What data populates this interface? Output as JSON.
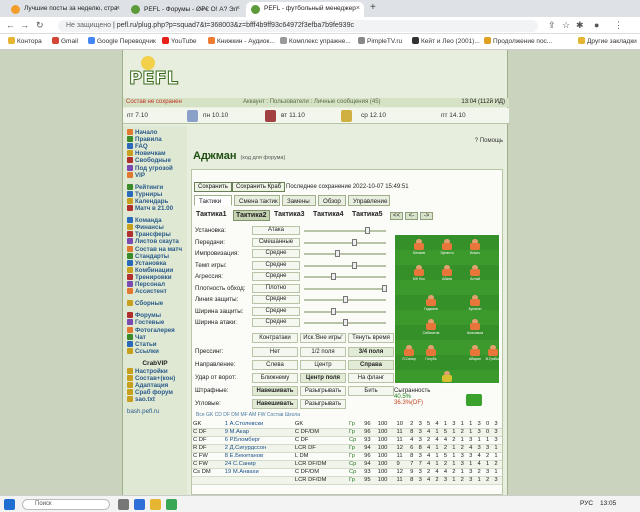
{
  "browser": {
    "tabs": [
      {
        "label": "Лучшие посты за неделю, стра",
        "close": "×"
      },
      {
        "label": "PEFL - Форумы - Ø₽€ О! А? Эл",
        "close": "×"
      },
      {
        "label": "PEFL - футбольный менеджер",
        "close": "×"
      }
    ],
    "new_tab": "+",
    "url_prefix": "Не защищено",
    "url": "pefl.ru/plug.php?p=squad7&t=368003&z=bfff4b9ff93c64972f3efba7b9fe939c",
    "bookmarks": [
      "Контора",
      "Gmail",
      "Google Переводчик",
      "YouTube",
      "Книжкин - Аудиок...",
      "Комплекс упражне...",
      "PimpleTV.ru",
      "Кейт и Лео (2001)...",
      "Продолжение пос...",
      "Другие закладки"
    ]
  },
  "site": {
    "logo_text": "PEFL",
    "status_left": "Состав не сохранен",
    "status_mid": "Аккаунт : Пользователи : Личные сообщения (45)",
    "status_right": "13:04 (112й ИД)",
    "matches": [
      {
        "day": "пт 7.10"
      },
      {
        "day": "пн 10.10"
      },
      {
        "day": "вт 11.10"
      },
      {
        "day": "ср 12.10"
      },
      {
        "day": "пт 14.10"
      }
    ]
  },
  "sidebar": {
    "groups": [
      [
        "Начало",
        "Правила",
        "FAQ",
        "Новичкам",
        "Свободные",
        "Под угрозой",
        "VIP"
      ],
      [
        "Рейтинги",
        "Турниры",
        "Календарь",
        "Матч в 21.00"
      ],
      [
        "Команда",
        "Финансы",
        "Трансферы",
        "Листов скаута",
        "Состав на матч",
        "Стандарты",
        "Установка",
        "Комбинации",
        "Тренировки",
        "Персонал",
        "Ассистент"
      ],
      [
        "Сборные"
      ],
      [
        "Форумы",
        "Гостевые",
        "Фотогалерея",
        "Чат",
        "Статьи",
        "Ссылки"
      ]
    ],
    "crabvip_title": "CrabVIP",
    "crabvip_items": [
      "Настройки",
      "Состав+(кон)",
      "Адаптация",
      "Cраб форум",
      "sao.txt"
    ],
    "bottom_link": "bash.pefl.ru"
  },
  "main": {
    "help": "Помощь",
    "team_name": "Аджман",
    "team_note": "(код для форума)",
    "save_label": "Сохранить",
    "save_crab_label": "Сохранить Краб",
    "last_saved": "Последнее сохранение 2022-10-07 15:49:51",
    "tabs": [
      "Тактики",
      "Смена тактик",
      "Замены",
      "Обзор",
      "Управление"
    ],
    "tactics": [
      "Тактика1",
      "Тактика2",
      "Тактика3",
      "Тактика4",
      "Тактика5"
    ],
    "tactic_nav": [
      "<<",
      "<-",
      "->"
    ],
    "settings": [
      {
        "label": "Установка:",
        "value": "Атака",
        "level": 0.78
      },
      {
        "label": "Передачи:",
        "value": "Смешанные",
        "level": 0.62
      },
      {
        "label": "Импровизация:",
        "value": "Средне",
        "level": 0.4
      },
      {
        "label": "Темп игры:",
        "value": "Средне",
        "level": 0.62
      },
      {
        "label": "Агрессия:",
        "value": "Средне",
        "level": 0.35
      },
      {
        "label": "Плотность обход:",
        "value": "Плотно",
        "level": 1.0
      },
      {
        "label": "Линия защиты:",
        "value": "Средне",
        "level": 0.5
      },
      {
        "label": "Ширина защиты:",
        "value": "Средне",
        "level": 0.35
      },
      {
        "label": "Ширина атаки:",
        "value": "Средне",
        "level": 0.5
      }
    ],
    "kontr": [
      "Контратаки",
      "Иск.'Вне игры'",
      "Тянуть время"
    ],
    "pressing": {
      "label": "Прессинг:",
      "options": [
        "Нет",
        "1/2 поля",
        "3/4 поля"
      ],
      "selected": 2
    },
    "direction": {
      "label": "Направление:",
      "options": [
        "Слева",
        "Центр",
        "Справа"
      ],
      "selected": 2
    },
    "shoot": {
      "label": "Удар от ворот:",
      "options": [
        "Ближнему",
        "Центр поля",
        "На фланг"
      ],
      "selected": 1
    },
    "fines": {
      "label": "Штрафные:",
      "options": [
        "Навешивать",
        "Разыгрывать",
        "Бить"
      ],
      "selected": 0
    },
    "corners": {
      "label": "Угловые:",
      "options": [
        "Навешивать",
        "Разыгрывать"
      ],
      "selected": 0
    },
    "coherence_label": "Сыгранность",
    "coherence_values": [
      "40.5%",
      "36.3%(DF)"
    ],
    "players_pitch": [
      "Беляев",
      "Эрнесто",
      "Ильич",
      "МК Нос",
      "Абаев",
      "Алтай",
      "Гаджиев",
      "Кулагин",
      "Сибагатов",
      "Анисимов",
      "Л.Санир",
      "Голубь",
      "Абарин",
      "В.Грибов",
      "Столевски"
    ],
    "table_links": "Все GK  CD  DF  DM  MF  AM  FW  Состав  Школа",
    "table_rows": [
      [
        "GK",
        "1 А.Столевски",
        "GK",
        "Гр",
        "96",
        "100",
        "10",
        "2",
        "3",
        "5",
        "4",
        "1",
        "3",
        "1",
        "1",
        "3",
        "0",
        "3"
      ],
      [
        "C DF",
        "9 М.Акар",
        "C DF/DM",
        "Гр",
        "96",
        "100",
        "11",
        "8",
        "3",
        "4",
        "1",
        "5",
        "1",
        "2",
        "1",
        "3",
        "0",
        "3"
      ],
      [
        "C DF",
        "6 Р.Бломберг",
        "C DF",
        "Ср",
        "93",
        "100",
        "11",
        "4",
        "3",
        "2",
        "4",
        "4",
        "2",
        "1",
        "3",
        "1",
        "1",
        "3"
      ],
      [
        "R DF",
        "2 Д.Сигурдссон",
        "LCR DF",
        "Гр",
        "94",
        "100",
        "12",
        "6",
        "8",
        "4",
        "1",
        "2",
        "1",
        "2",
        "4",
        "3",
        "3",
        "1"
      ],
      [
        "C FW",
        "8 Е.Бекетанов",
        "L DM",
        "Гр",
        "96",
        "100",
        "11",
        "8",
        "3",
        "4",
        "1",
        "5",
        "1",
        "3",
        "3",
        "4",
        "2",
        "1"
      ],
      [
        "C FW",
        "24 С.Санир",
        "LCR DF/DM",
        "Ср",
        "94",
        "100",
        "9",
        "7",
        "7",
        "4",
        "1",
        "2",
        "1",
        "3",
        "1",
        "4",
        "1",
        "2"
      ],
      [
        "Cs DM",
        "19 М.Анваxи",
        "C DF/DM",
        "Ср",
        "93",
        "100",
        "12",
        "9",
        "3",
        "2",
        "4",
        "4",
        "2",
        "1",
        "3",
        "2",
        "3",
        "1"
      ],
      [
        "",
        "",
        "LCR DF/DM",
        "Гр",
        "95",
        "100",
        "11",
        "8",
        "3",
        "4",
        "2",
        "3",
        "1",
        "2",
        "3",
        "1",
        "2",
        "3"
      ]
    ]
  },
  "taskbar": {
    "search": "Поиск",
    "lang": "РУС",
    "time": "13:05"
  }
}
